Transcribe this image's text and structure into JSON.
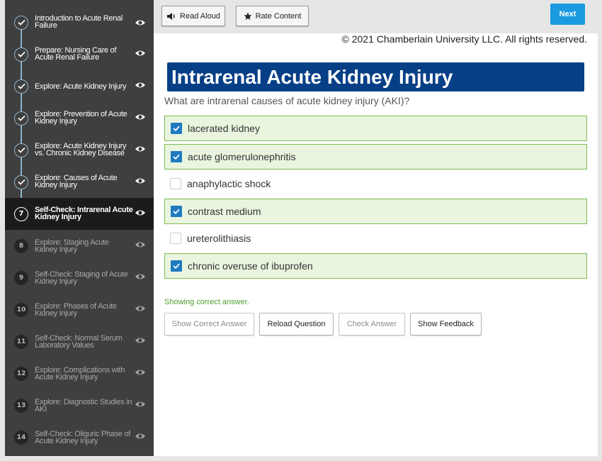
{
  "sidebar": {
    "items": [
      {
        "number": "",
        "label_lines": [
          "Introduction to Acute Renal",
          "Failure"
        ],
        "state": "done"
      },
      {
        "number": "",
        "label_lines": [
          "Prepare: Nursing Care of",
          "Acute Renal Failure"
        ],
        "state": "done"
      },
      {
        "number": "",
        "label_lines": [
          "Explore: Acute Kidney Injury"
        ],
        "state": "done"
      },
      {
        "number": "",
        "label_lines": [
          "Explore: Prevention of Acute",
          "Kidney Injury"
        ],
        "state": "done"
      },
      {
        "number": "",
        "label_lines": [
          "Explore: Acute Kidney Injury",
          "vs. Chronic Kidney Disease"
        ],
        "state": "done"
      },
      {
        "number": "",
        "label_lines": [
          "Explore: Causes of Acute",
          "Kidney Injury"
        ],
        "state": "done"
      },
      {
        "number": "7",
        "label_lines": [
          "Self-Check: Intrarenal Acute",
          "Kidney Injury"
        ],
        "state": "current"
      },
      {
        "number": "8",
        "label_lines": [
          "Explore: Staging Acute",
          "Kidney Injury"
        ],
        "state": "pending"
      },
      {
        "number": "9",
        "label_lines": [
          "Self-Check: Staging of Acute",
          "Kidney Injury"
        ],
        "state": "pending"
      },
      {
        "number": "10",
        "label_lines": [
          "Explore: Phases of Acute",
          "Kidney Injury"
        ],
        "state": "pending"
      },
      {
        "number": "11",
        "label_lines": [
          "Self-Check: Normal Serum",
          "Laboratory Values"
        ],
        "state": "pending"
      },
      {
        "number": "12",
        "label_lines": [
          "Explore: Complications with",
          "Acute Kidney Injury"
        ],
        "state": "pending"
      },
      {
        "number": "13",
        "label_lines": [
          "Explore: Diagnostic Studies in",
          "AKI"
        ],
        "state": "pending"
      },
      {
        "number": "14",
        "label_lines": [
          "Self-Check: Oliguric Phase of",
          "Acute Kidney Injury"
        ],
        "state": "pending"
      }
    ]
  },
  "toolbar": {
    "read_aloud_label": "Read Aloud",
    "rate_content_label": "Rate Content",
    "next_label": "Next"
  },
  "content": {
    "copyright": "© 2021 Chamberlain University LLC. All rights reserved.",
    "title": "Intrarenal Acute Kidney Injury",
    "question": "What are intrarenal causes of acute kidney injury (AKI)?",
    "options": [
      {
        "label": "lacerated kidney",
        "checked": true
      },
      {
        "label": "acute glomerulonephritis",
        "checked": true
      },
      {
        "label": "anaphylactic shock",
        "checked": false
      },
      {
        "label": "contrast medium",
        "checked": true
      },
      {
        "label": "ureterolithiasis",
        "checked": false
      },
      {
        "label": "chronic overuse of ibuprofen",
        "checked": true
      }
    ],
    "status_text": "Showing correct answer.",
    "buttons": {
      "show_correct": "Show Correct Answer",
      "reload": "Reload Question",
      "check": "Check Answer",
      "feedback": "Show Feedback"
    }
  },
  "colors": {
    "title_bg": "#063f86",
    "next_bg": "#1a9be0",
    "correct_border": "#7dbb4f",
    "correct_bg": "#e9f5df",
    "checkbox": "#1f7bbf",
    "status": "#4aa02c"
  }
}
